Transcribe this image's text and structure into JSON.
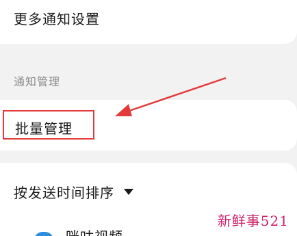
{
  "more_settings": {
    "label": "更多通知设置"
  },
  "section": {
    "title": "通知管理"
  },
  "batch": {
    "label": "批量管理"
  },
  "sort": {
    "label": "按发送时间排序"
  },
  "app_item": {
    "name": "咪咕视频"
  },
  "watermark": {
    "text": "新鲜事521"
  },
  "colors": {
    "highlight_box": "#e33b3b",
    "arrow": "#e33b3b",
    "watermark": "#d11f6a",
    "section_text": "#8a8a8a"
  },
  "icons": [
    "chevron-down-icon",
    "app-icon"
  ]
}
